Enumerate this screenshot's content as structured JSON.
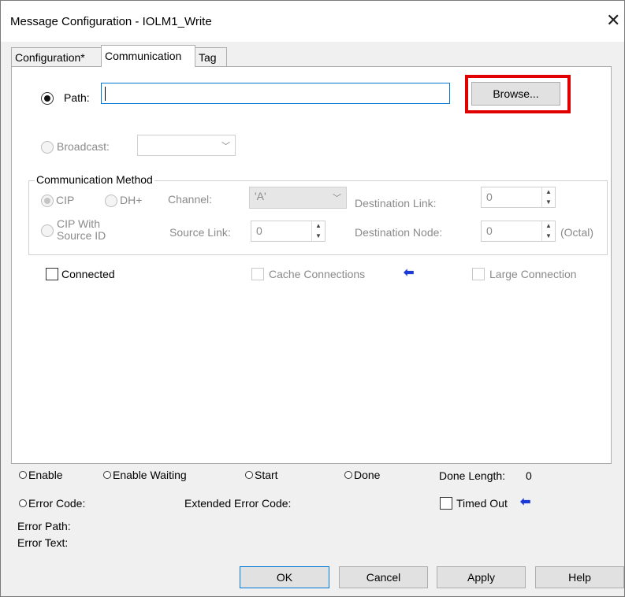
{
  "window": {
    "title": "Message Configuration - IOLM1_Write",
    "close_glyph": "✕"
  },
  "tabs": [
    {
      "label": "Configuration*"
    },
    {
      "label": "Communication"
    },
    {
      "label": "Tag"
    }
  ],
  "path": {
    "label": "Path:",
    "value": "",
    "browse_label": "Browse..."
  },
  "broadcast": {
    "label": "Broadcast:"
  },
  "comm_method": {
    "legend": "Communication Method",
    "cip_label": "CIP",
    "dh_label": "DH+",
    "cip_source_line1": "CIP With",
    "cip_source_line2": "Source ID",
    "channel_label": "Channel:",
    "channel_value": "'A'",
    "dest_link_label": "Destination Link:",
    "dest_link_value": "0",
    "source_link_label": "Source Link:",
    "source_link_value": "0",
    "dest_node_label": "Destination Node:",
    "dest_node_value": "0",
    "octal_label": "(Octal)"
  },
  "options": {
    "connected_label": "Connected",
    "cache_label": "Cache Connections",
    "large_label": "Large Connection"
  },
  "status": {
    "enable": "Enable",
    "enable_waiting": "Enable Waiting",
    "start": "Start",
    "done": "Done",
    "done_length_label": "Done Length:",
    "done_length_value": "0",
    "error_code": "Error Code:",
    "extended_error_code": "Extended Error Code:",
    "timed_out": "Timed Out",
    "error_path": "Error Path:",
    "error_text": "Error Text:"
  },
  "buttons": {
    "ok": "OK",
    "cancel": "Cancel",
    "apply": "Apply",
    "help": "Help"
  },
  "colors": {
    "highlight": "#e00000",
    "arrow": "#1d39d6",
    "focus": "#0078d7"
  },
  "icons": {
    "arrow": "left-arrow-icon",
    "close": "close-icon"
  }
}
